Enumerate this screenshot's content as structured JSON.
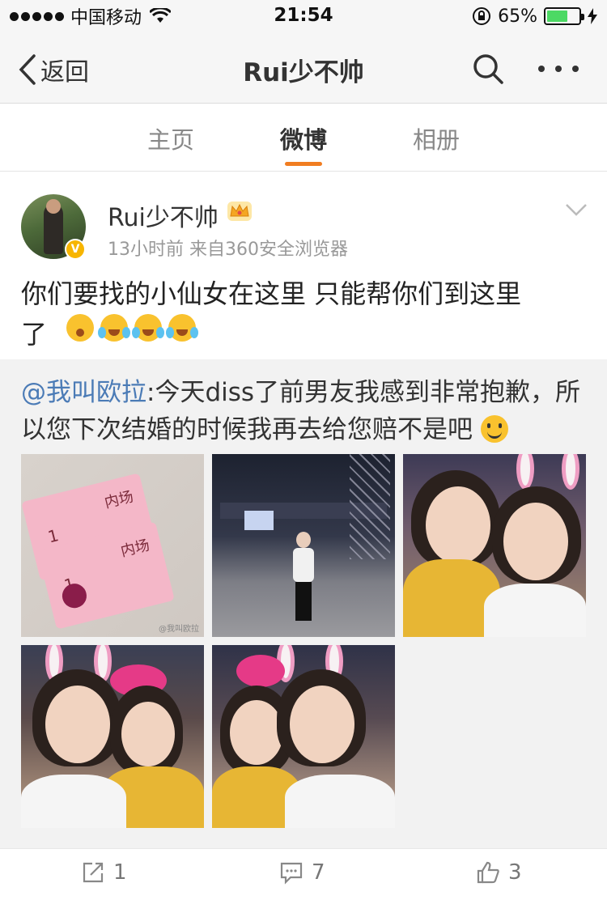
{
  "status_bar": {
    "carrier": "中国移动",
    "time": "21:54",
    "battery_percent": "65%",
    "battery_level": 0.65
  },
  "nav": {
    "back_label": "返回",
    "title": "Rui少不帅"
  },
  "tabs": [
    {
      "label": "主页",
      "active": false
    },
    {
      "label": "微博",
      "active": true
    },
    {
      "label": "相册",
      "active": false
    }
  ],
  "post": {
    "user_name": "Rui少不帅",
    "verified_badge": "V",
    "meta": "13小时前  来自360安全浏览器",
    "text_line1": "你们要找的小仙女在这里  只能帮你们到这里",
    "text_line2": "了",
    "emoji_icons": [
      "fearful-face-icon",
      "crying-laughing-icon",
      "crying-laughing-icon",
      "crying-laughing-icon"
    ]
  },
  "repost": {
    "mention": "@我叫欧拉",
    "text": ":今天diss了前男友我感到非常抱歉，所以您下次结婚的时候我再去给您赔不是吧",
    "photos": [
      {
        "name": "photo-tickets",
        "ticket_label": "内场",
        "ticket_number": "1",
        "watermark": "@我叫欧拉"
      },
      {
        "name": "photo-stadium"
      },
      {
        "name": "photo-selfie-1"
      },
      {
        "name": "photo-selfie-2"
      },
      {
        "name": "photo-selfie-3"
      }
    ]
  },
  "actions": {
    "repost_count": "1",
    "comment_count": "7",
    "like_count": "3"
  },
  "colors": {
    "accent": "#f17d21",
    "mention": "#4b7bb6",
    "badge": "#f7b500",
    "battery": "#4cd964"
  }
}
